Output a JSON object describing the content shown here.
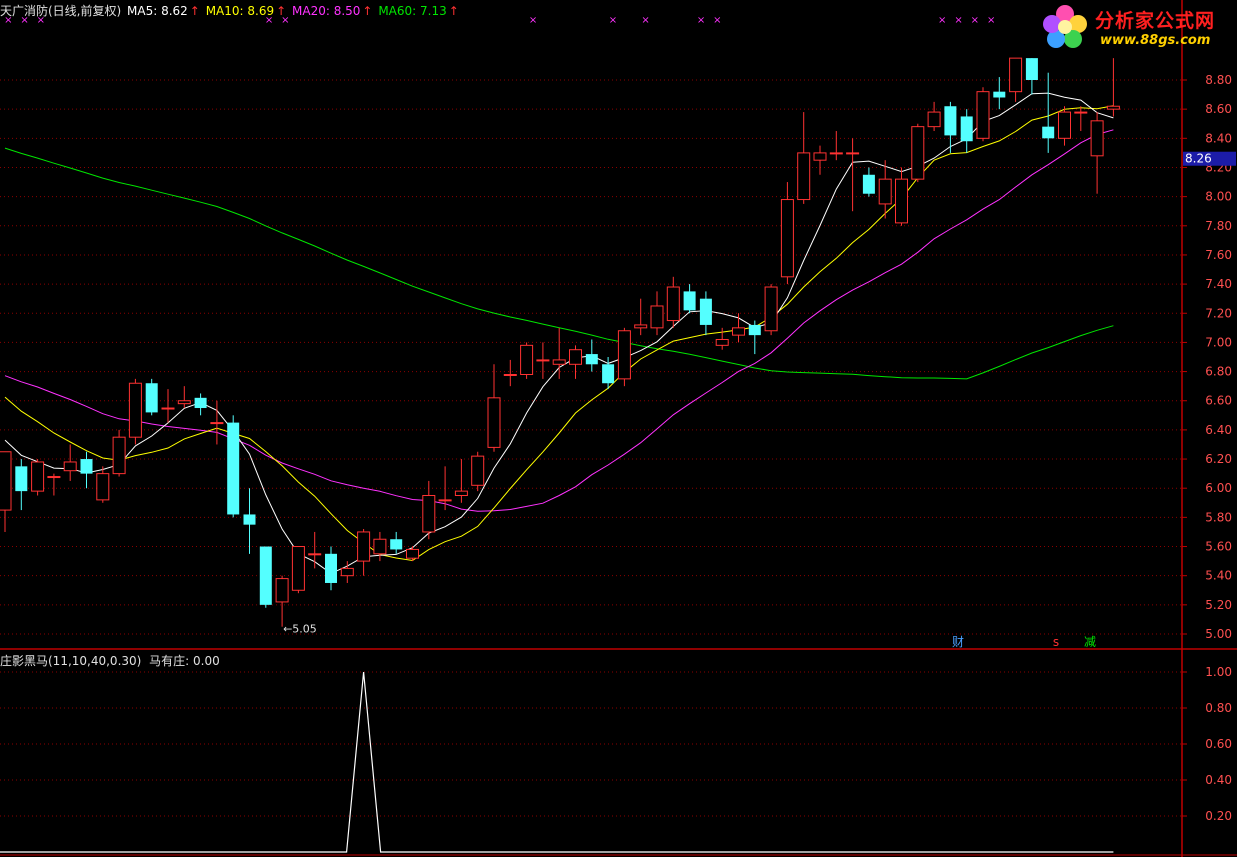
{
  "header": {
    "stock": "天广消防(日线,前复权)",
    "ma5": "MA5: 8.62",
    "ma10": "MA10: 8.69",
    "ma20": "MA20: 8.50",
    "ma60": "MA60: 7.13",
    "arrow": "↑"
  },
  "logo": {
    "title": "分析家公式网",
    "url": "www.88gs.com"
  },
  "sub_header": {
    "indicator": "庄影黑马(11,10,40,0.30)",
    "value": "马有庄: 0.00"
  },
  "markers": {
    "low_label": "5.05",
    "cai": "财",
    "s": "s",
    "jian": "减",
    "cross": "×"
  },
  "colors": {
    "up": "#ff3232",
    "down": "#54ffff",
    "ma5": "#ffffff",
    "ma10": "#ffff00",
    "ma20": "#ff32ff",
    "ma60": "#00e600",
    "grid": "#8b0000",
    "axis": "#c00000"
  },
  "chart_data": [
    {
      "type": "candlestick",
      "title": "天广消防(日线,前复权)",
      "current_price": "8.26",
      "y_ticks": [
        "8.80",
        "8.60",
        "8.40",
        "8.20",
        "8.00",
        "7.80",
        "7.60",
        "7.40",
        "7.20",
        "7.00",
        "6.80",
        "6.60",
        "6.40",
        "6.20",
        "6.00",
        "5.80",
        "5.60",
        "5.40",
        "5.20",
        "5.00"
      ],
      "ylim": [
        4.95,
        8.95
      ],
      "candles": [
        [
          5.85,
          6.25,
          6.25,
          5.7
        ],
        [
          6.15,
          5.98,
          6.2,
          5.85
        ],
        [
          5.98,
          6.18,
          6.2,
          5.95
        ],
        [
          6.08,
          6.08,
          6.1,
          5.95
        ],
        [
          6.12,
          6.18,
          6.3,
          6.05
        ],
        [
          6.2,
          6.1,
          6.25,
          6.0
        ],
        [
          5.92,
          6.1,
          6.15,
          5.9
        ],
        [
          6.1,
          6.35,
          6.4,
          6.08
        ],
        [
          6.35,
          6.72,
          6.75,
          6.3
        ],
        [
          6.72,
          6.52,
          6.75,
          6.5
        ],
        [
          6.55,
          6.55,
          6.68,
          6.45
        ],
        [
          6.58,
          6.6,
          6.7,
          6.55
        ],
        [
          6.62,
          6.55,
          6.65,
          6.5
        ],
        [
          6.45,
          6.45,
          6.6,
          6.3
        ],
        [
          6.45,
          5.82,
          6.5,
          5.8
        ],
        [
          5.82,
          5.75,
          6.0,
          5.55
        ],
        [
          5.6,
          5.2,
          5.6,
          5.18
        ],
        [
          5.22,
          5.38,
          5.4,
          5.05
        ],
        [
          5.3,
          5.6,
          5.6,
          5.28
        ],
        [
          5.55,
          5.55,
          5.7,
          5.45
        ],
        [
          5.55,
          5.35,
          5.6,
          5.3
        ],
        [
          5.4,
          5.45,
          5.5,
          5.35
        ],
        [
          5.5,
          5.7,
          5.72,
          5.4
        ],
        [
          5.55,
          5.65,
          5.7,
          5.5
        ],
        [
          5.65,
          5.58,
          5.7,
          5.55
        ],
        [
          5.52,
          5.58,
          5.6,
          5.5
        ],
        [
          5.7,
          5.95,
          6.05,
          5.65
        ],
        [
          5.92,
          5.92,
          6.15,
          5.85
        ],
        [
          5.95,
          5.98,
          6.2,
          5.9
        ],
        [
          6.02,
          6.22,
          6.25,
          5.98
        ],
        [
          6.28,
          6.62,
          6.85,
          6.25
        ],
        [
          6.78,
          6.78,
          6.88,
          6.7
        ],
        [
          6.78,
          6.98,
          7.0,
          6.75
        ],
        [
          6.88,
          6.88,
          7.0,
          6.75
        ],
        [
          6.85,
          6.88,
          7.1,
          6.75
        ],
        [
          6.85,
          6.95,
          6.98,
          6.75
        ],
        [
          6.92,
          6.85,
          7.02,
          6.8
        ],
        [
          6.85,
          6.72,
          6.9,
          6.68
        ],
        [
          6.75,
          7.08,
          7.1,
          6.7
        ],
        [
          7.1,
          7.12,
          7.3,
          7.05
        ],
        [
          7.1,
          7.25,
          7.35,
          7.05
        ],
        [
          7.15,
          7.38,
          7.45,
          7.1
        ],
        [
          7.35,
          7.22,
          7.4,
          7.2
        ],
        [
          7.3,
          7.12,
          7.35,
          7.05
        ],
        [
          6.98,
          7.02,
          7.1,
          6.95
        ],
        [
          7.05,
          7.1,
          7.2,
          7.0
        ],
        [
          7.12,
          7.05,
          7.15,
          6.92
        ],
        [
          7.08,
          7.38,
          7.4,
          7.05
        ],
        [
          7.45,
          7.98,
          8.1,
          7.4
        ],
        [
          7.98,
          8.3,
          8.58,
          7.95
        ],
        [
          8.25,
          8.3,
          8.35,
          8.15
        ],
        [
          8.3,
          8.3,
          8.45,
          8.25
        ],
        [
          8.3,
          8.3,
          8.4,
          7.9
        ],
        [
          8.15,
          8.02,
          8.2,
          8.0
        ],
        [
          7.95,
          8.12,
          8.25,
          7.85
        ],
        [
          7.82,
          8.12,
          8.2,
          7.8
        ],
        [
          8.12,
          8.48,
          8.5,
          8.1
        ],
        [
          8.48,
          8.58,
          8.65,
          8.45
        ],
        [
          8.62,
          8.42,
          8.65,
          8.3
        ],
        [
          8.55,
          8.38,
          8.6,
          8.3
        ],
        [
          8.4,
          8.72,
          8.75,
          8.38
        ],
        [
          8.72,
          8.68,
          8.82,
          8.6
        ],
        [
          8.72,
          8.95,
          8.95,
          8.65
        ],
        [
          8.95,
          8.8,
          8.95,
          8.7
        ],
        [
          8.48,
          8.4,
          8.85,
          8.3
        ],
        [
          8.4,
          8.58,
          8.62,
          8.35
        ],
        [
          8.58,
          8.58,
          8.62,
          8.45
        ],
        [
          8.28,
          8.52,
          8.58,
          8.02
        ],
        [
          8.6,
          8.62,
          8.95,
          8.55
        ]
      ]
    },
    {
      "type": "line",
      "title": "庄影黑马(11,10,40,0.30)",
      "y_ticks": [
        "1.00",
        "0.80",
        "0.60",
        "0.40",
        "0.20"
      ],
      "ylim": [
        0,
        1.05
      ],
      "spike": {
        "index": 22,
        "value": 1.0
      }
    }
  ]
}
